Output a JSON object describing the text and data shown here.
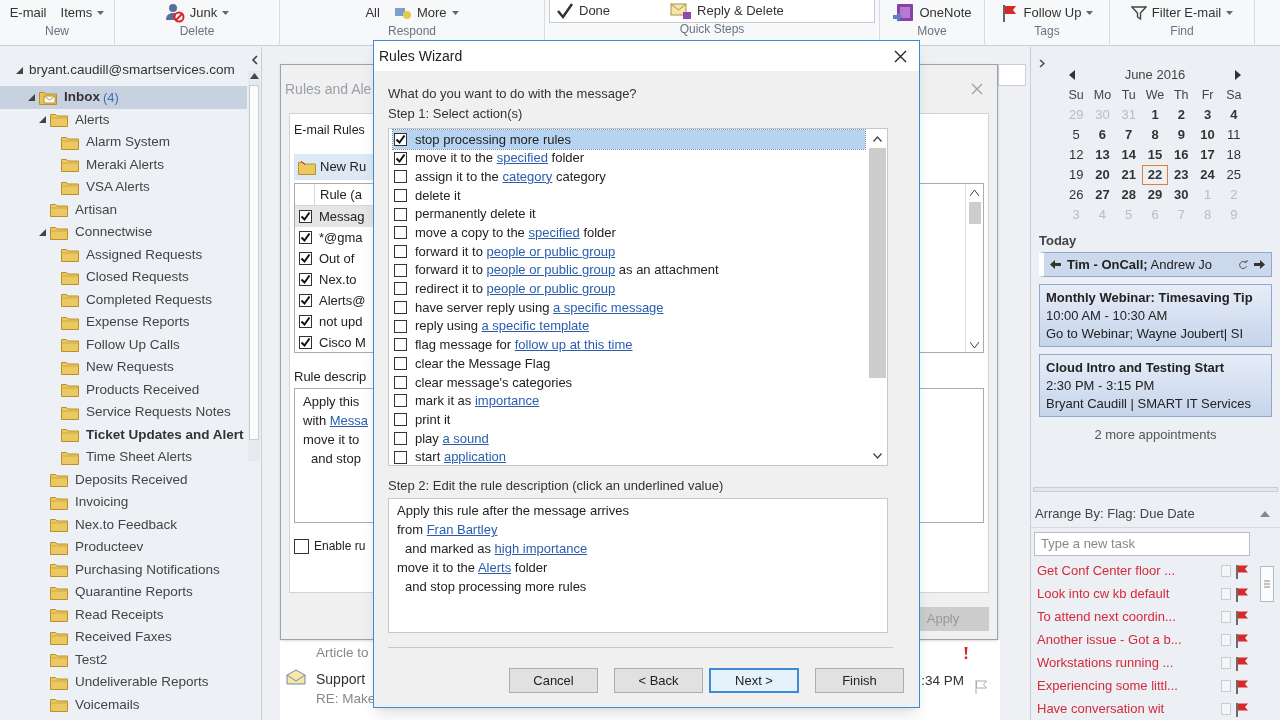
{
  "ribbon": {
    "groups": [
      {
        "label": "New",
        "buttons": [
          {
            "label": "E-mail",
            "kind": "plain",
            "dropdown": false
          },
          {
            "label": "Items",
            "kind": "plain",
            "dropdown": true
          }
        ]
      },
      {
        "label": "Delete",
        "buttons": [
          {
            "label": "Junk",
            "kind": "junk",
            "dropdown": true
          }
        ]
      },
      {
        "label": "Respond",
        "buttons": [
          {
            "label": "All",
            "kind": "plain",
            "dropdown": false
          },
          {
            "label": "More",
            "kind": "more",
            "dropdown": true
          }
        ]
      },
      {
        "label": "Quick Steps",
        "buttons": [
          {
            "label": "Done",
            "kind": "check",
            "dropdown": false
          },
          {
            "label": "Reply & Delete",
            "kind": "reply-delete",
            "dropdown": false
          }
        ]
      },
      {
        "label": "Move",
        "buttons": [
          {
            "label": "OneNote",
            "kind": "onenote",
            "dropdown": false
          }
        ]
      },
      {
        "label": "Tags",
        "buttons": [
          {
            "label": "Follow Up",
            "kind": "flag",
            "dropdown": true
          }
        ]
      },
      {
        "label": "Find",
        "buttons": [
          {
            "label": "Filter E-mail",
            "kind": "filter",
            "dropdown": true
          }
        ]
      }
    ]
  },
  "folders": {
    "account": "bryant.caudill@smartservices.com",
    "expanded": true,
    "items": [
      {
        "name": "Inbox",
        "count": "(4)",
        "kind": "inbox",
        "unread": true,
        "selected": true,
        "expanded": true,
        "children": [
          {
            "name": "Alerts",
            "kind": "folder",
            "unread": false,
            "selected": false,
            "expanded": true,
            "children": [
              {
                "name": "Alarm System",
                "kind": "folder",
                "unread": false,
                "selected": false
              },
              {
                "name": "Meraki Alerts",
                "kind": "folder",
                "unread": false,
                "selected": false
              },
              {
                "name": "VSA Alerts",
                "kind": "folder",
                "unread": false,
                "selected": false
              }
            ]
          },
          {
            "name": "Artisan",
            "kind": "folder",
            "unread": false,
            "selected": false
          },
          {
            "name": "Connectwise",
            "kind": "folder",
            "unread": false,
            "selected": false,
            "expanded": true,
            "children": [
              {
                "name": "Assigned Requests",
                "kind": "folder",
                "unread": false,
                "selected": false
              },
              {
                "name": "Closed Requests",
                "kind": "folder",
                "unread": false,
                "selected": false
              },
              {
                "name": "Completed Requests",
                "kind": "folder",
                "unread": false,
                "selected": false
              },
              {
                "name": "Expense Reports",
                "kind": "folder",
                "unread": false,
                "selected": false
              },
              {
                "name": "Follow Up Calls",
                "kind": "folder",
                "unread": false,
                "selected": false
              },
              {
                "name": "New Requests",
                "kind": "folder",
                "unread": false,
                "selected": false
              },
              {
                "name": "Products Received",
                "kind": "folder",
                "unread": false,
                "selected": false
              },
              {
                "name": "Service Requests Notes",
                "kind": "folder",
                "unread": false,
                "selected": false
              },
              {
                "name": "Ticket Updates and Alert",
                "kind": "folder",
                "unread": true,
                "selected": false
              },
              {
                "name": "Time Sheet Alerts",
                "kind": "folder",
                "unread": false,
                "selected": false
              }
            ]
          },
          {
            "name": "Deposits Received",
            "kind": "folder",
            "unread": false,
            "selected": false
          },
          {
            "name": "Invoicing",
            "kind": "folder",
            "unread": false,
            "selected": false
          },
          {
            "name": "Nex.to Feedback",
            "kind": "folder",
            "unread": false,
            "selected": false
          },
          {
            "name": "Producteev",
            "kind": "folder",
            "unread": false,
            "selected": false
          },
          {
            "name": "Purchasing Notifications",
            "kind": "folder",
            "unread": false,
            "selected": false
          },
          {
            "name": "Quarantine Reports",
            "kind": "folder",
            "unread": false,
            "selected": false
          },
          {
            "name": "Read Receipts",
            "kind": "folder",
            "unread": false,
            "selected": false
          },
          {
            "name": "Received Faxes",
            "kind": "folder",
            "unread": false,
            "selected": false
          },
          {
            "name": "Test2",
            "kind": "folder",
            "unread": false,
            "selected": false
          },
          {
            "name": "Undeliverable Reports",
            "kind": "folder",
            "unread": false,
            "selected": false
          },
          {
            "name": "Voicemails",
            "kind": "folder",
            "unread": false,
            "selected": false
          }
        ]
      }
    ]
  },
  "rules_dialog": {
    "title": "Rules and Ale",
    "tab": "E-mail Rules",
    "new_button": "New Ru",
    "column_header": "Rule (a",
    "rules": [
      {
        "name": "Messag",
        "checked": true,
        "selected": true
      },
      {
        "name": "*@gma",
        "checked": true,
        "selected": false
      },
      {
        "name": "Out of",
        "checked": true,
        "selected": false
      },
      {
        "name": "Nex.to",
        "checked": true,
        "selected": false
      },
      {
        "name": "Alerts@",
        "checked": true,
        "selected": false
      },
      {
        "name": "not upd",
        "checked": true,
        "selected": false
      },
      {
        "name": "Cisco M",
        "checked": true,
        "selected": false
      }
    ],
    "description_label": "Rule descrip",
    "description": [
      {
        "parts": [
          {
            "text": "Apply this",
            "link": false
          }
        ],
        "indented": false
      },
      {
        "parts": [
          {
            "text": "with ",
            "link": false
          },
          {
            "text": "Messa",
            "link": true
          }
        ],
        "indented": false
      },
      {
        "parts": [
          {
            "text": "move it to",
            "link": false
          }
        ],
        "indented": false
      },
      {
        "parts": [
          {
            "text": "and stop",
            "link": false
          }
        ],
        "indented": true
      }
    ],
    "enable_label": "Enable ru",
    "enable_checked": false,
    "apply_button": {
      "label": "Apply",
      "disabled": true
    }
  },
  "messages": [
    {
      "preview": "Article to",
      "important": true
    },
    {
      "sender": "Support",
      "preview": "RE: Make",
      "time": ":34 PM",
      "important": false
    }
  ],
  "wizard": {
    "title": "Rules Wizard",
    "question": "What do you want to do with the message?",
    "step1_label": "Step 1: Select action(s)",
    "actions": [
      {
        "parts": [
          {
            "text": "stop processing more rules",
            "link": false
          }
        ],
        "checked": true,
        "selected": true
      },
      {
        "parts": [
          {
            "text": "move it to the ",
            "link": false
          },
          {
            "text": "specified",
            "link": true
          },
          {
            "text": " folder",
            "link": false
          }
        ],
        "checked": true,
        "selected": false
      },
      {
        "parts": [
          {
            "text": "assign it to the ",
            "link": false
          },
          {
            "text": "category",
            "link": true
          },
          {
            "text": " category",
            "link": false
          }
        ],
        "checked": false,
        "selected": false
      },
      {
        "parts": [
          {
            "text": "delete it",
            "link": false
          }
        ],
        "checked": false,
        "selected": false
      },
      {
        "parts": [
          {
            "text": "permanently delete it",
            "link": false
          }
        ],
        "checked": false,
        "selected": false
      },
      {
        "parts": [
          {
            "text": "move a copy to the ",
            "link": false
          },
          {
            "text": "specified",
            "link": true
          },
          {
            "text": " folder",
            "link": false
          }
        ],
        "checked": false,
        "selected": false
      },
      {
        "parts": [
          {
            "text": "forward it to ",
            "link": false
          },
          {
            "text": "people or public group",
            "link": true
          }
        ],
        "checked": false,
        "selected": false
      },
      {
        "parts": [
          {
            "text": "forward it to ",
            "link": false
          },
          {
            "text": "people or public group",
            "link": true
          },
          {
            "text": " as an attachment",
            "link": false
          }
        ],
        "checked": false,
        "selected": false
      },
      {
        "parts": [
          {
            "text": "redirect it to ",
            "link": false
          },
          {
            "text": "people or public group",
            "link": true
          }
        ],
        "checked": false,
        "selected": false
      },
      {
        "parts": [
          {
            "text": "have server reply using ",
            "link": false
          },
          {
            "text": "a specific message",
            "link": true
          }
        ],
        "checked": false,
        "selected": false
      },
      {
        "parts": [
          {
            "text": "reply using ",
            "link": false
          },
          {
            "text": "a specific template",
            "link": true
          }
        ],
        "checked": false,
        "selected": false
      },
      {
        "parts": [
          {
            "text": "flag message for ",
            "link": false
          },
          {
            "text": "follow up at this time",
            "link": true
          }
        ],
        "checked": false,
        "selected": false
      },
      {
        "parts": [
          {
            "text": "clear the Message Flag",
            "link": false
          }
        ],
        "checked": false,
        "selected": false
      },
      {
        "parts": [
          {
            "text": "clear message's categories",
            "link": false
          }
        ],
        "checked": false,
        "selected": false
      },
      {
        "parts": [
          {
            "text": "mark it as ",
            "link": false
          },
          {
            "text": "importance",
            "link": true
          }
        ],
        "checked": false,
        "selected": false
      },
      {
        "parts": [
          {
            "text": "print it",
            "link": false
          }
        ],
        "checked": false,
        "selected": false
      },
      {
        "parts": [
          {
            "text": "play ",
            "link": false
          },
          {
            "text": "a sound",
            "link": true
          }
        ],
        "checked": false,
        "selected": false
      },
      {
        "parts": [
          {
            "text": "start ",
            "link": false
          },
          {
            "text": "application",
            "link": true
          }
        ],
        "checked": false,
        "selected": false
      }
    ],
    "step2_label": "Step 2: Edit the rule description (click an underlined value)",
    "description": [
      {
        "parts": [
          {
            "text": "Apply this rule after the message arrives",
            "link": false
          }
        ],
        "indented": false
      },
      {
        "parts": [
          {
            "text": "from ",
            "link": false
          },
          {
            "text": "Fran Bartley",
            "link": true
          }
        ],
        "indented": false
      },
      {
        "parts": [
          {
            "text": "and marked as ",
            "link": false
          },
          {
            "text": "high importance",
            "link": true
          }
        ],
        "indented": true
      },
      {
        "parts": [
          {
            "text": "move it to the ",
            "link": false
          },
          {
            "text": "Alerts",
            "link": true
          },
          {
            "text": " folder",
            "link": false
          }
        ],
        "indented": false
      },
      {
        "parts": [
          {
            "text": "and stop processing more rules",
            "link": false
          }
        ],
        "indented": true
      }
    ],
    "buttons": [
      {
        "label": "Cancel",
        "default": false
      },
      {
        "label": "< Back",
        "default": false
      },
      {
        "label": "Next >",
        "default": true
      },
      {
        "label": "Finish",
        "default": false
      }
    ]
  },
  "calendar": {
    "month": "June 2016",
    "weekdays": [
      "Su",
      "Mo",
      "Tu",
      "We",
      "Th",
      "Fr",
      "Sa"
    ],
    "weeks": [
      [
        {
          "n": "29",
          "muted": true,
          "bold": false,
          "today": false
        },
        {
          "n": "30",
          "muted": true,
          "bold": false,
          "today": false
        },
        {
          "n": "31",
          "muted": true,
          "bold": false,
          "today": false
        },
        {
          "n": "1",
          "muted": false,
          "bold": true,
          "today": false
        },
        {
          "n": "2",
          "muted": false,
          "bold": true,
          "today": false
        },
        {
          "n": "3",
          "muted": false,
          "bold": true,
          "today": false
        },
        {
          "n": "4",
          "muted": false,
          "bold": true,
          "today": false
        }
      ],
      [
        {
          "n": "5",
          "muted": false,
          "bold": false,
          "today": false
        },
        {
          "n": "6",
          "muted": false,
          "bold": true,
          "today": false
        },
        {
          "n": "7",
          "muted": false,
          "bold": true,
          "today": false
        },
        {
          "n": "8",
          "muted": false,
          "bold": true,
          "today": false
        },
        {
          "n": "9",
          "muted": false,
          "bold": true,
          "today": false
        },
        {
          "n": "10",
          "muted": false,
          "bold": true,
          "today": false
        },
        {
          "n": "11",
          "muted": false,
          "bold": false,
          "today": false
        }
      ],
      [
        {
          "n": "12",
          "muted": false,
          "bold": false,
          "today": false
        },
        {
          "n": "13",
          "muted": false,
          "bold": true,
          "today": false
        },
        {
          "n": "14",
          "muted": false,
          "bold": true,
          "today": false
        },
        {
          "n": "15",
          "muted": false,
          "bold": true,
          "today": false
        },
        {
          "n": "16",
          "muted": false,
          "bold": true,
          "today": false
        },
        {
          "n": "17",
          "muted": false,
          "bold": true,
          "today": false
        },
        {
          "n": "18",
          "muted": false,
          "bold": false,
          "today": false
        }
      ],
      [
        {
          "n": "19",
          "muted": false,
          "bold": false,
          "today": false
        },
        {
          "n": "20",
          "muted": false,
          "bold": true,
          "today": false
        },
        {
          "n": "21",
          "muted": false,
          "bold": true,
          "today": false
        },
        {
          "n": "22",
          "muted": false,
          "bold": true,
          "today": true
        },
        {
          "n": "23",
          "muted": false,
          "bold": true,
          "today": false
        },
        {
          "n": "24",
          "muted": false,
          "bold": true,
          "today": false
        },
        {
          "n": "25",
          "muted": false,
          "bold": false,
          "today": false
        }
      ],
      [
        {
          "n": "26",
          "muted": false,
          "bold": false,
          "today": false
        },
        {
          "n": "27",
          "muted": false,
          "bold": true,
          "today": false
        },
        {
          "n": "28",
          "muted": false,
          "bold": true,
          "today": false
        },
        {
          "n": "29",
          "muted": false,
          "bold": true,
          "today": false
        },
        {
          "n": "30",
          "muted": false,
          "bold": true,
          "today": false
        },
        {
          "n": "1",
          "muted": true,
          "bold": false,
          "today": false
        },
        {
          "n": "2",
          "muted": true,
          "bold": false,
          "today": false
        }
      ],
      [
        {
          "n": "3",
          "muted": true,
          "bold": false,
          "today": false
        },
        {
          "n": "4",
          "muted": true,
          "bold": false,
          "today": false
        },
        {
          "n": "5",
          "muted": true,
          "bold": false,
          "today": false
        },
        {
          "n": "6",
          "muted": true,
          "bold": false,
          "today": false
        },
        {
          "n": "7",
          "muted": true,
          "bold": false,
          "today": false
        },
        {
          "n": "8",
          "muted": true,
          "bold": false,
          "today": false
        },
        {
          "n": "9",
          "muted": true,
          "bold": false,
          "today": false
        }
      ]
    ]
  },
  "agenda": {
    "heading": "Today",
    "banner": "**Tim - OnCall;** Andrew Jo",
    "appointments": [
      {
        "title": "Monthly Webinar: Timesaving Tip",
        "time": "10:00 AM - 10:30 AM",
        "detail": "Go to Webinar; Wayne Joubert| SI"
      },
      {
        "title": "Cloud Intro and Testing Start",
        "time": "2:30 PM - 3:15 PM",
        "detail": "Bryant Caudill | SMART IT Services"
      }
    ],
    "more": "2 more appointments"
  },
  "tasks": {
    "arrange": "Arrange By: Flag: Due Date",
    "placeholder": "Type a new task",
    "items": [
      {
        "text": "Get Conf Center floor ...",
        "done": false
      },
      {
        "text": "Look into cw kb default",
        "done": false
      },
      {
        "text": "To attend next coordin...",
        "done": false
      },
      {
        "text": "Another issue - Got a b...",
        "done": false
      },
      {
        "text": "Workstations running ...",
        "done": false
      },
      {
        "text": "Experiencing some littl...",
        "done": false
      },
      {
        "text": "Have conversation wit",
        "done": false
      }
    ]
  }
}
